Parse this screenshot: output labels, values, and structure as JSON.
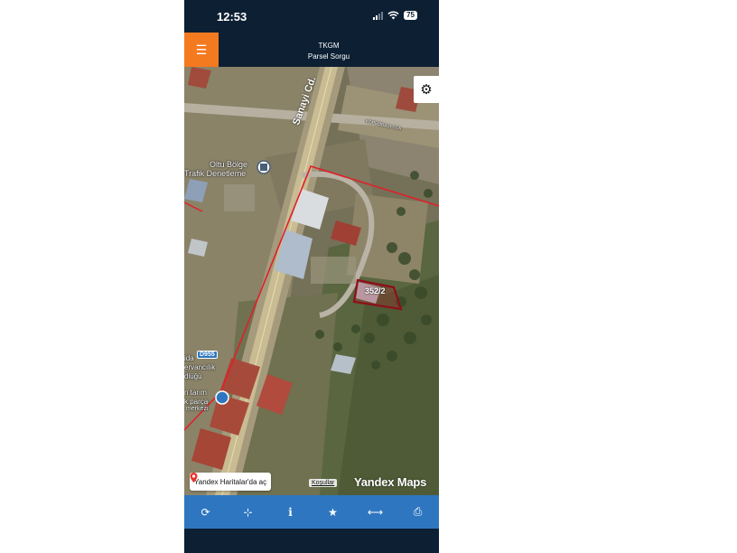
{
  "status_bar": {
    "time": "12:53",
    "battery": "75"
  },
  "header": {
    "title": "TKGM",
    "subtitle": "Parsel Sorgu",
    "menu_icon": "hamburger-icon"
  },
  "map": {
    "settings_icon": "gear-icon",
    "parcel_label": "352/2",
    "road_label": "Sanayi Cd.",
    "poi_labels": {
      "trafik_1": "Oltu Bölge",
      "trafik_2": "Trafik Denetleme",
      "poi_left_1": "ida",
      "poi_left_2": "ervancılık",
      "poi_left_3": "dlüğü",
      "poi_left_4": "n tarım",
      "poi_left_5": "k parça",
      "poi_left_6": "merkezi",
      "street_label": "KÖPRÜBAŞI SOK."
    },
    "route_badge": "D955",
    "yandex_open_label": "Yandex Haritalar'da aç",
    "kosullar_label": "Koşullar",
    "logo": "Yandex Maps"
  },
  "toolbar": {
    "buttons": [
      {
        "icon": "refresh-icon",
        "glyph": "⟳"
      },
      {
        "icon": "locate-icon",
        "glyph": "⊹"
      },
      {
        "icon": "info-icon",
        "glyph": "i"
      },
      {
        "icon": "star-icon",
        "glyph": "★"
      },
      {
        "icon": "measure-icon",
        "glyph": "⟷"
      },
      {
        "icon": "print-icon",
        "glyph": "⎙"
      }
    ]
  },
  "colors": {
    "accent": "#f47a20",
    "toolbar": "#2e77c0",
    "header": "#0c1f33",
    "parcel": "#b01828",
    "boundary": "#e0202a"
  }
}
